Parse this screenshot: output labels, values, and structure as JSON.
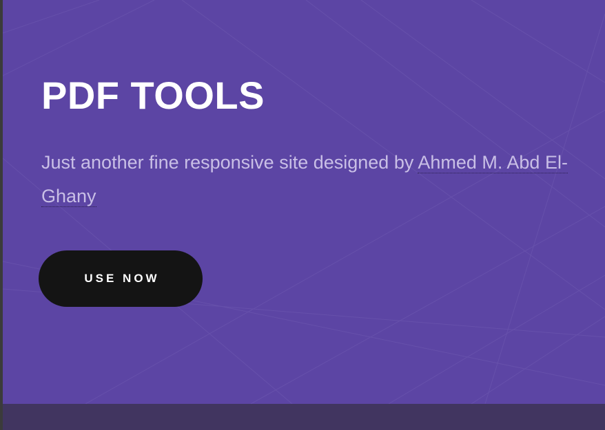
{
  "hero": {
    "title": "PDF TOOLS",
    "tagline_prefix": "Just another fine responsive site designed by ",
    "author_link": "Ahmed M. Abd El-Ghany",
    "cta_label": "USE NOW"
  },
  "colors": {
    "hero_background": "#5c45a4",
    "title": "#ffffff",
    "tagline": "#c9bfe6",
    "button_background": "#141414",
    "button_text": "#ffffff",
    "bottom_bar": "#413560"
  }
}
